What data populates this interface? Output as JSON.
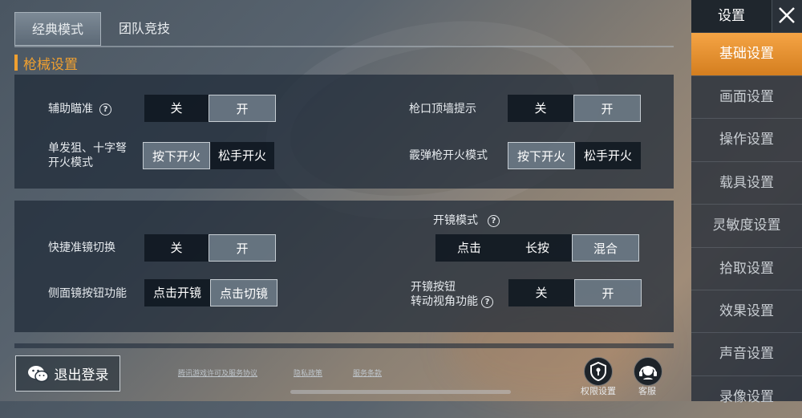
{
  "tabs": [
    {
      "label": "经典模式",
      "active": true
    },
    {
      "label": "团队竞技",
      "active": false
    }
  ],
  "section_title": "枪械设置",
  "panel1": {
    "aim_assist": {
      "label": "辅助瞄准",
      "options": [
        "关",
        "开"
      ],
      "selected": "开"
    },
    "muzzle_wall": {
      "label": "枪口顶墙提示",
      "options": [
        "关",
        "开"
      ],
      "selected": "开"
    },
    "sniper_fire": {
      "label_line1": "单发狙、十字弩",
      "label_line2": "开火模式",
      "options": [
        "按下开火",
        "松手开火"
      ],
      "selected": "按下开火"
    },
    "shotgun_fire": {
      "label": "霰弹枪开火模式",
      "options": [
        "按下开火",
        "松手开火"
      ],
      "selected": "按下开火"
    }
  },
  "panel2": {
    "quick_scope": {
      "label": "快捷准镜切换",
      "options": [
        "关",
        "开"
      ],
      "selected": "开"
    },
    "scope_mode": {
      "label": "开镜模式",
      "options": [
        "点击",
        "长按",
        "混合"
      ],
      "selected": "混合"
    },
    "side_scope": {
      "label": "侧面镜按钮功能",
      "options": [
        "点击开镜",
        "点击切镜"
      ],
      "selected": "点击切镜"
    },
    "scope_rotate": {
      "label_line1": "开镜按钮",
      "label_line2": "转动视角功能",
      "options": [
        "关",
        "开"
      ],
      "selected": "开"
    }
  },
  "sidebar": {
    "title": "设置",
    "items": [
      {
        "label": "基础设置",
        "active": true
      },
      {
        "label": "画面设置",
        "active": false
      },
      {
        "label": "操作设置",
        "active": false
      },
      {
        "label": "载具设置",
        "active": false
      },
      {
        "label": "灵敏度设置",
        "active": false
      },
      {
        "label": "拾取设置",
        "active": false
      },
      {
        "label": "效果设置",
        "active": false
      },
      {
        "label": "声音设置",
        "active": false
      },
      {
        "label": "录像设置",
        "active": false
      }
    ]
  },
  "footer": {
    "logout_label": "退出登录",
    "links": [
      "腾讯游戏许可及服务协议",
      "隐私政策",
      "服务条款"
    ],
    "permission_label": "权限设置",
    "service_label": "客服"
  },
  "colors": {
    "accent": "#f0a030",
    "active_tab": "#e8922e"
  }
}
